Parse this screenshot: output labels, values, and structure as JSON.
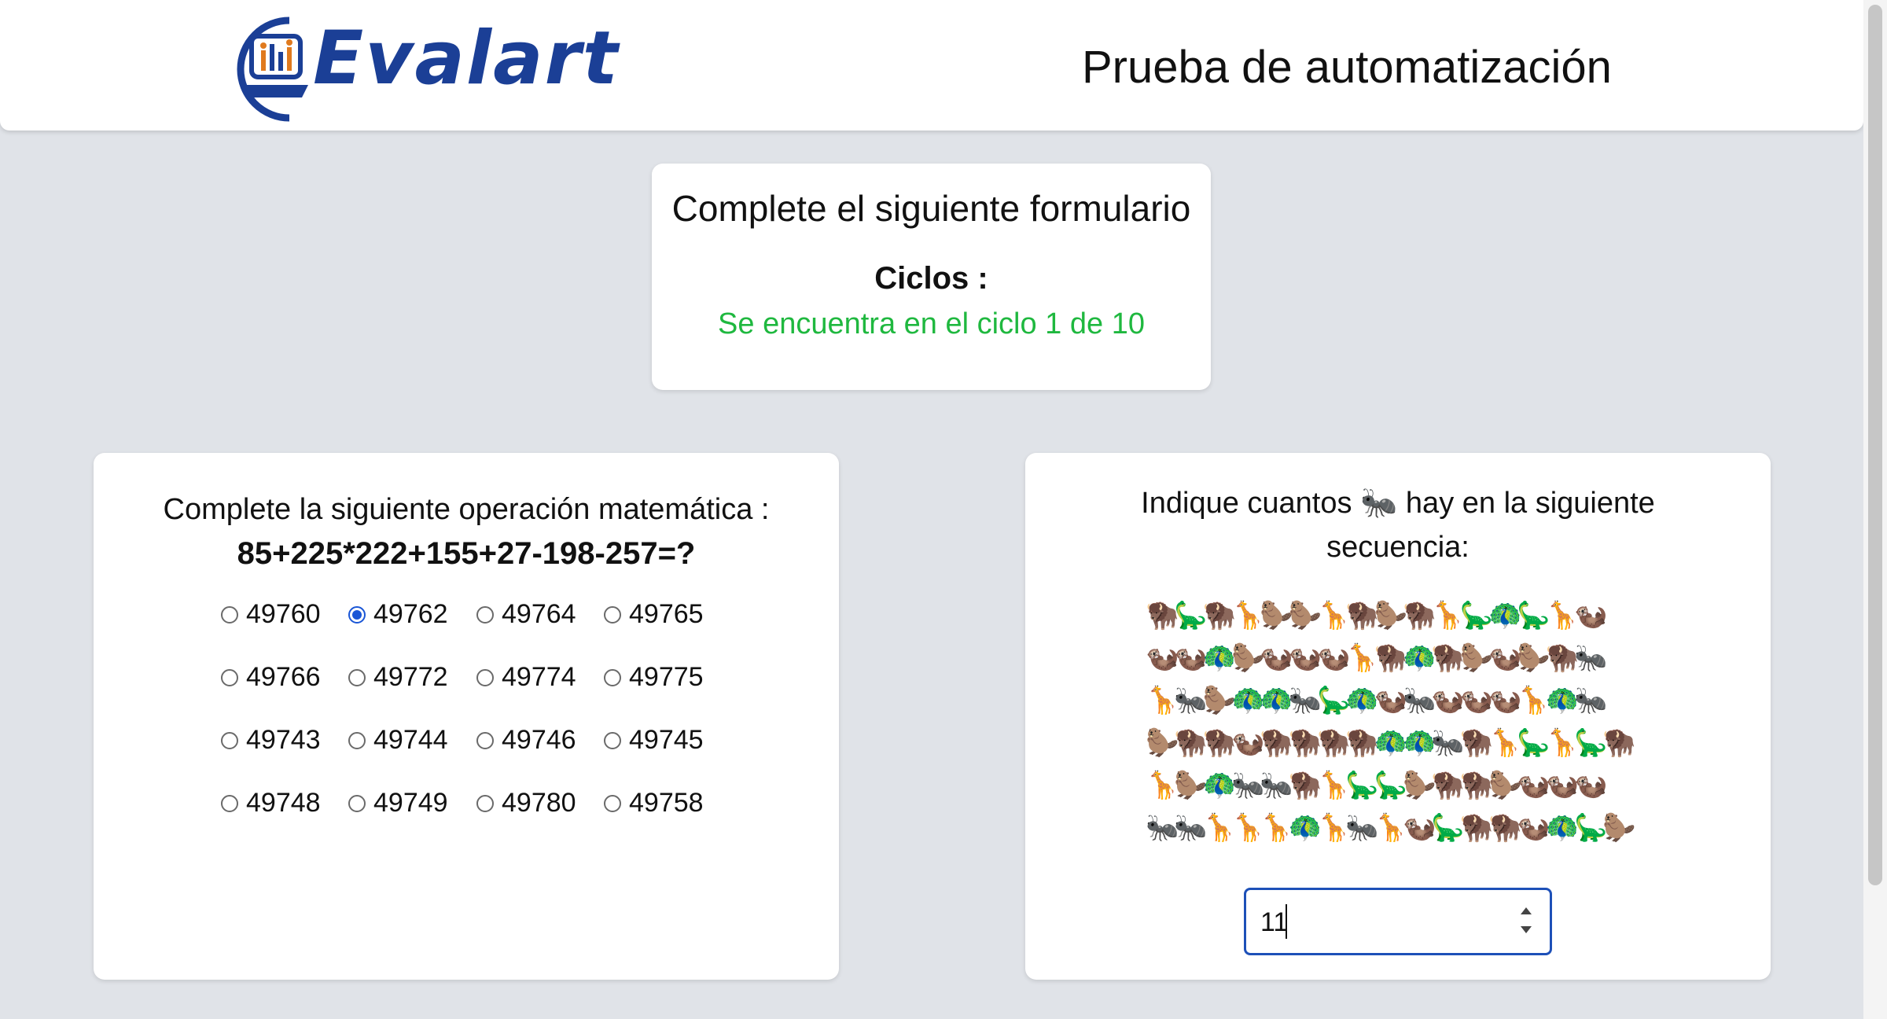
{
  "header": {
    "logo_text": "Evalart",
    "title": "Prueba de automatización"
  },
  "status_card": {
    "title": "Complete el siguiente formulario",
    "cycles_label": "Ciclos :",
    "cycle_status": "Se encuentra en el ciclo 1 de 10"
  },
  "math_card": {
    "question": "Complete la siguiente operación matemática :",
    "operation": "85+225*222+155+27-198-257=?",
    "options": [
      "49760",
      "49762",
      "49764",
      "49765",
      "49766",
      "49772",
      "49774",
      "49775",
      "49743",
      "49744",
      "49746",
      "49745",
      "49748",
      "49749",
      "49780",
      "49758"
    ],
    "selected": "49762"
  },
  "count_card": {
    "question": "Indique cuantos 🐜 hay en la siguiente secuencia:",
    "sequence_rows": [
      "🦬🦕🦬🦒🦫🦫🦒🦬🦫🦬🦒🦕🦚🦕🦒🦦",
      "🦦🦦🦚🦫🦦🦦🦦🦒🦬🦚🦬🦫🦦🦫🦬🐜",
      "🦒🐜🦫🦚🦚🐜🦕🦚🦦🐜🦦🦦🦦🦒🦚🐜",
      "🦫🦬🦬🦦🦬🦬🦬🦬🦚🦚🐜🦬🦒🦕🦒🦕🦬",
      "🦒🦫🦚🐜🐜🦬🦒🦕🦕🦫🦬🦬🦫🦦🦦🦦",
      "🐜🐜🦒🦒🦒🦚🦒🐜🦒🦦🦕🦬🦬🦦🦚🦕🦫"
    ],
    "answer_value": "11"
  }
}
